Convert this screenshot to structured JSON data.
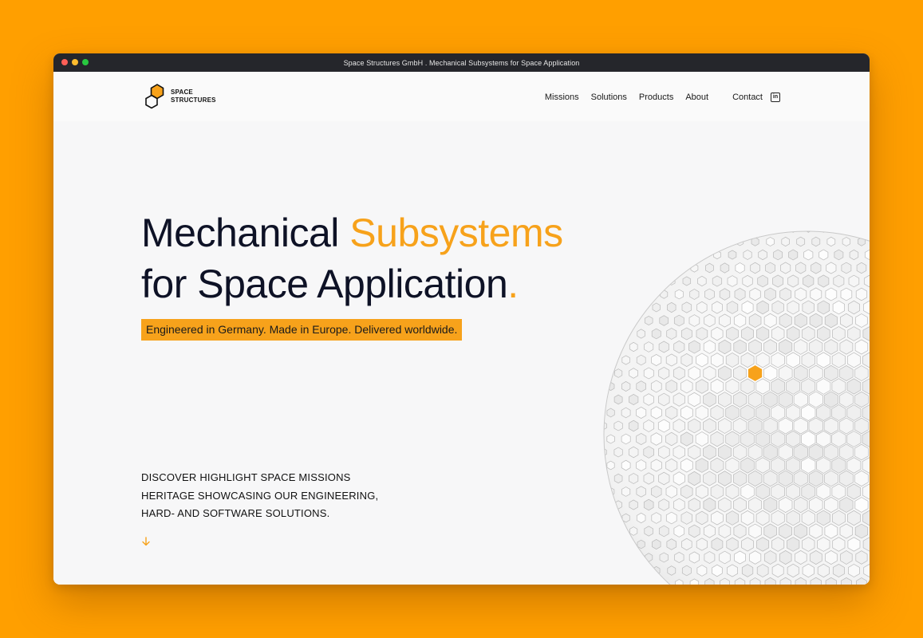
{
  "window": {
    "title": "Space Structures GmbH . Mechanical Subsystems for Space Application"
  },
  "header": {
    "logo_line1": "SPACE",
    "logo_line2": "STRUCTURES",
    "nav": [
      {
        "label": "Missions"
      },
      {
        "label": "Solutions"
      },
      {
        "label": "Products"
      },
      {
        "label": "About"
      },
      {
        "label": "Contact"
      }
    ],
    "social_icon": "linkedin-icon",
    "social_glyph": "in"
  },
  "hero": {
    "title_part1": "Mechanical ",
    "title_accent": "Subsystems",
    "title_line2": "for Space Application",
    "title_dot": ".",
    "tagline": "Engineered in Germany. Made in Europe. Delivered worldwide.",
    "discover_lines": [
      "DISCOVER HIGHLIGHT SPACE MISSIONS",
      "HERITAGE SHOWCASING OUR ENGINEERING,",
      "HARD- AND SOFTWARE SOLUTIONS."
    ],
    "scroll_icon": "arrow-down-icon"
  },
  "colors": {
    "background": "#FF9F00",
    "accent": "#F7A21B",
    "text_dark": "#0e1226",
    "titlebar": "#25262b"
  }
}
